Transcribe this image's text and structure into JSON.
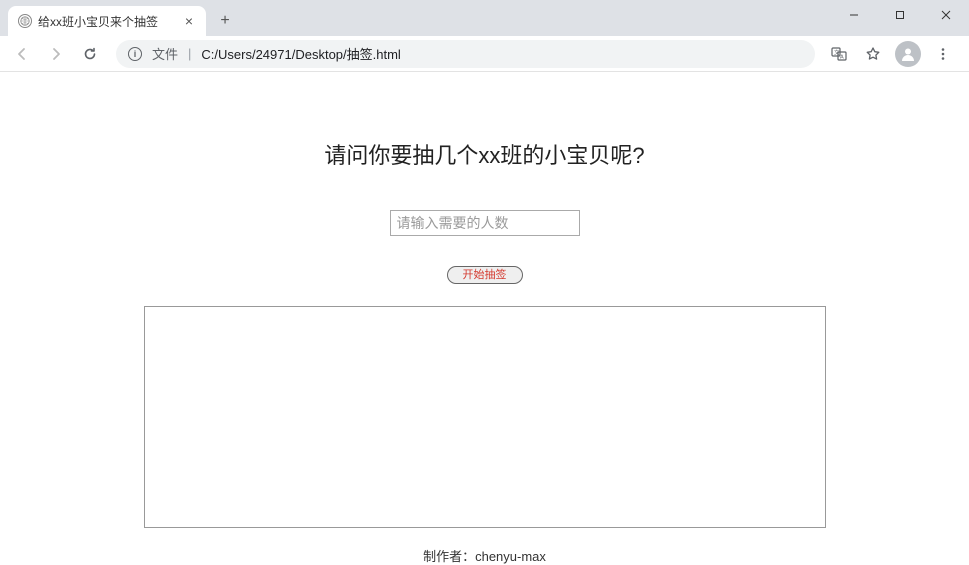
{
  "browser": {
    "tab_title": "给xx班小宝贝来个抽签",
    "address": {
      "label": "文件",
      "url": "C:/Users/24971/Desktop/抽签.html"
    }
  },
  "page": {
    "heading": "请问你要抽几个xx班的小宝贝呢?",
    "input_placeholder": "请输入需要的人数",
    "start_button": "开始抽签",
    "footer": "制作者：chenyu-max"
  }
}
